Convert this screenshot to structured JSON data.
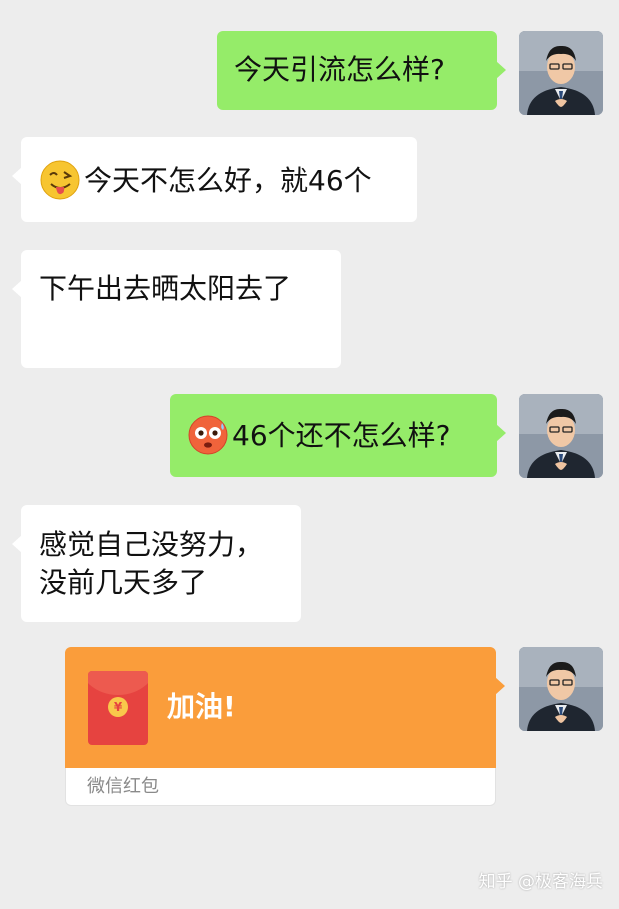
{
  "messages": [
    {
      "from": "me",
      "text": "今天引流怎么样?"
    },
    {
      "from": "them",
      "emoji": "winking-tongue-emoji",
      "text": "今天不怎么好，就46个"
    },
    {
      "from": "them",
      "text": "下午出去晒太阳去了"
    },
    {
      "from": "me",
      "emoji": "flushed-emoji",
      "text": "46个还不怎么样?"
    },
    {
      "from": "them",
      "lines": [
        "感觉自己没努力，",
        "没前几天多了"
      ]
    }
  ],
  "red_packet": {
    "message": "加油!",
    "label": "微信红包",
    "currency_symbol": "¥"
  },
  "watermark": "知乎 @极客海兵",
  "colors": {
    "background": "#ededed",
    "my_bubble": "#95ec69",
    "their_bubble": "#ffffff",
    "red_packet": "#fa9d3b",
    "envelope": "#e64340"
  }
}
